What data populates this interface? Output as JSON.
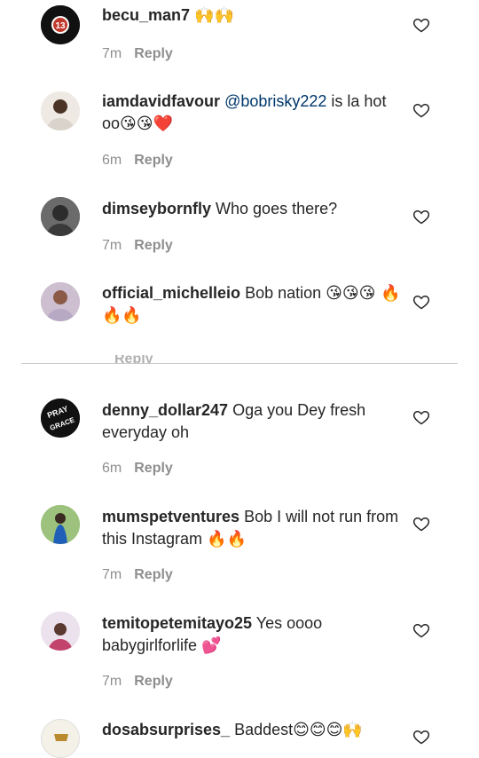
{
  "comments": [
    {
      "username": "becu_man7",
      "text": "",
      "emoji": "🙌🙌",
      "time": "7m",
      "reply": "Reply"
    },
    {
      "username": "iamdavidfavour",
      "mention": "@bobrisky222",
      "text": " is la hot oo",
      "emoji": "😘😘❤️",
      "time": "6m",
      "reply": "Reply"
    },
    {
      "username": "dimseybornfly",
      "text": " Who goes there?",
      "time": "7m",
      "reply": "Reply"
    },
    {
      "username": "official_michelleio",
      "text": " Bob nation ",
      "emoji": "😘😘😘 🔥🔥🔥",
      "time": "",
      "reply": "Reply"
    },
    {
      "username": "denny_dollar247",
      "text": " Oga you Dey fresh everyday oh",
      "time": "6m",
      "reply": "Reply"
    },
    {
      "username": "mumspetventures",
      "text": " Bob I will not run from this Instagram ",
      "emoji": "🔥🔥",
      "time": "7m",
      "reply": "Reply"
    },
    {
      "username": "temitopetemitayo25",
      "text": " Yes oooo babygirlforlife ",
      "emoji": "💕",
      "time": "7m",
      "reply": "Reply"
    },
    {
      "username": "dosabsurprises_",
      "text": " Baddest",
      "emoji": "😊😊😊🙌"
    }
  ],
  "avatars": {
    "becu_badge": "13",
    "denny_badge_top": "PRAY",
    "denny_badge_bottom": "GRACE"
  },
  "colors": {
    "text": "#262626",
    "meta": "#8e8e8e",
    "mention": "#00376b",
    "divider": "#c9c9c9"
  }
}
